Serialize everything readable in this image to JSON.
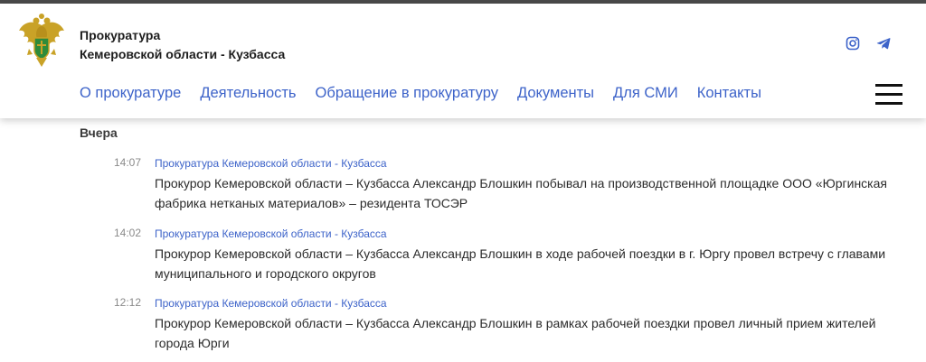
{
  "org": {
    "line1": "Прокуратура",
    "line2": "Кемеровской области - Кузбасса"
  },
  "social": {
    "instagram_icon": "instagram-icon",
    "telegram_icon": "telegram-icon",
    "color": "#3d63c9"
  },
  "nav": {
    "items": [
      {
        "label": "О прокуратуре"
      },
      {
        "label": "Деятельность"
      },
      {
        "label": "Обращение в прокуратуру"
      },
      {
        "label": "Документы"
      },
      {
        "label": "Для СМИ"
      },
      {
        "label": "Контакты"
      }
    ],
    "menu_icon": "hamburger-menu-icon"
  },
  "feed": {
    "day_label": "Вчера",
    "items": [
      {
        "time": "14:07",
        "source": "Прокуратура Кемеровской области - Кузбасса",
        "title": "Прокурор Кемеровской области – Кузбасса Александр Блошкин побывал на производственной площадке ООО «Юргинская фабрика нетканых материалов» – резидента ТОСЭР"
      },
      {
        "time": "14:02",
        "source": "Прокуратура Кемеровской области - Кузбасса",
        "title": "Прокурор Кемеровской области – Кузбасса Александр Блошкин в ходе рабочей поездки в г. Юргу провел встречу с главами муниципального и городского округов"
      },
      {
        "time": "12:12",
        "source": "Прокуратура Кемеровской области - Кузбасса",
        "title": "Прокурор Кемеровской области – Кузбасса Александр Блошкин в рамках рабочей поездки провел личный прием жителей города Юрги"
      }
    ]
  },
  "colors": {
    "link": "#3d63c9",
    "text": "#2b2b2b",
    "muted": "#8a8a8a",
    "emblem_gold": "#c9a227",
    "emblem_green": "#2e8b3a"
  }
}
